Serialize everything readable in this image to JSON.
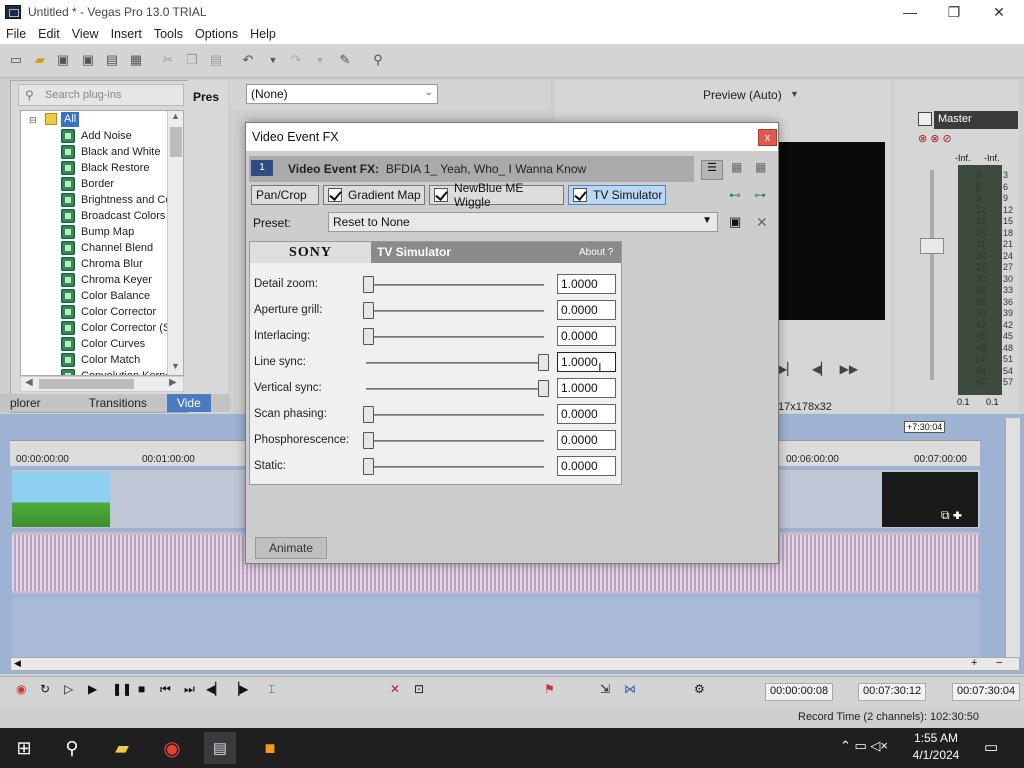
{
  "window": {
    "title": "Untitled * - Vegas Pro 13.0 TRIAL",
    "minimize": "—",
    "maximize": "❐",
    "close": "✕"
  },
  "menu": [
    "File",
    "Edit",
    "View",
    "Insert",
    "Tools",
    "Options",
    "Help"
  ],
  "plugins": {
    "search_placeholder": "Search plug-ins",
    "presets_header": "Pres",
    "root": "All",
    "items": [
      "Add Noise",
      "Black and White",
      "Black Restore",
      "Border",
      "Brightness and Co",
      "Broadcast Colors",
      "Bump Map",
      "Channel Blend",
      "Chroma Blur",
      "Chroma Keyer",
      "Color Balance",
      "Color Corrector",
      "Color Corrector (S",
      "Color Curves",
      "Color Match",
      "Convolution Kerne"
    ],
    "tabs": [
      "plorer",
      "Transitions",
      "Vide"
    ]
  },
  "preview": {
    "none_select": "(None)",
    "mode": "Preview (Auto)",
    "resolution": "17x178x32"
  },
  "master": {
    "label": "Master",
    "inf_left": "-Inf.",
    "inf_right": "-Inf.",
    "ticks": [
      "3",
      "6",
      "9",
      "12",
      "15",
      "18",
      "21",
      "24",
      "27",
      "30",
      "33",
      "36",
      "39",
      "42",
      "45",
      "48",
      "51",
      "54",
      "57"
    ],
    "foot_left": "0.1",
    "foot_right": "0.1"
  },
  "timeline": {
    "ruler": [
      "00:00:00:00",
      "00:01:00:00",
      "00:06:00:00",
      "00:07:00:00"
    ],
    "cursor_tip": "+7:30:04"
  },
  "transport": {
    "tc1": "00:00:00:08",
    "tc2": "00:07:30:12",
    "tc3": "00:07:30:04"
  },
  "status": {
    "record_time": "Record Time (2 channels): 102:30:50"
  },
  "taskbar": {
    "time": "1:55 AM",
    "date": "4/1/2024"
  },
  "dialog": {
    "title": "Video Event FX",
    "close": "x",
    "chain_badge": "1",
    "chain_label": "Video Event FX:",
    "chain_value": "BFDIA 1_ Yeah, Who_ I Wanna Know",
    "tabs": [
      "Pan/Crop",
      "Gradient Map",
      "NewBlue ME Wiggle",
      "TV Simulator"
    ],
    "preset_label": "Preset:",
    "preset_value": "Reset to None",
    "brand": "SONY",
    "plugin_name": "TV Simulator",
    "about": "About  ?",
    "params": [
      {
        "label": "Detail zoom:",
        "value": "1.0000",
        "level": 0
      },
      {
        "label": "Aperture grill:",
        "value": "0.0000",
        "level": 0
      },
      {
        "label": "Interlacing:",
        "value": "0.0000",
        "level": 0
      },
      {
        "label": "Line sync:",
        "value": "1.0000",
        "level": 1
      },
      {
        "label": "Vertical sync:",
        "value": "1.0000",
        "level": 1
      },
      {
        "label": "Scan phasing:",
        "value": "0.0000",
        "level": 0
      },
      {
        "label": "Phosphorescence:",
        "value": "0.0000",
        "level": 0
      },
      {
        "label": "Static:",
        "value": "0.0000",
        "level": 0
      }
    ],
    "animate": "Animate"
  }
}
